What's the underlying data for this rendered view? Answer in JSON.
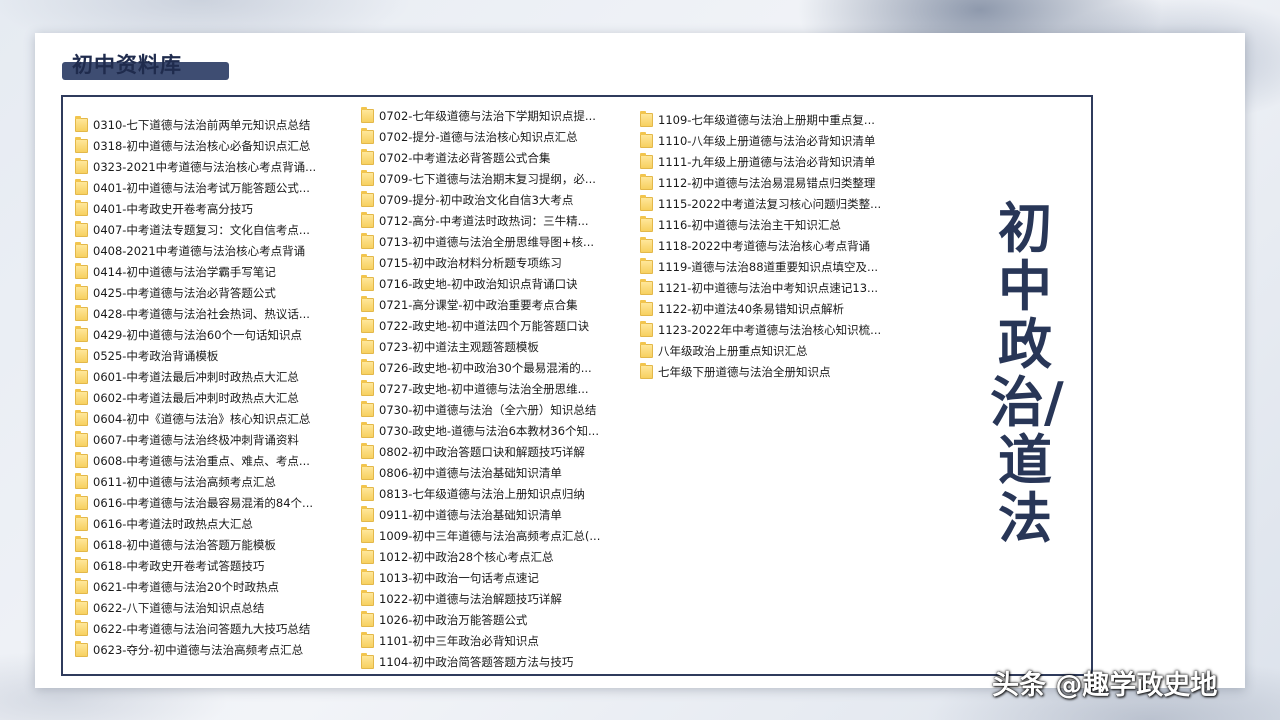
{
  "header": {
    "title": "初中资料库"
  },
  "side_title": "初中政治/道法",
  "watermark": "头条 @趣学政史地",
  "columns": [
    [
      "0310-七下道德与法治前两单元知识点总结",
      "0318-初中道德与法治核心必备知识点汇总",
      "0323-2021中考道德与法治核心考点背诵...",
      "0401-初中道德与法治考试万能答题公式...",
      "0401-中考政史开卷考高分技巧",
      "0407-中考道法专题复习：文化自信考点...",
      "0408-2021中考道德与法治核心考点背诵",
      "0414-初中道德与法治学霸手写笔记",
      "0425-中考道德与法治必背答题公式",
      "0428-中考道德与法治社会热词、热议话...",
      "0429-初中道德与法治60个一句话知识点",
      "0525-中考政治背诵模板",
      "0601-中考道法最后冲刺时政热点大汇总",
      "0602-中考道法最后冲刺时政热点大汇总",
      "0604-初中《道德与法治》核心知识点汇总",
      "0607-中考道德与法治终极冲刺背诵资料",
      "0608-中考道德与法治重点、难点、考点...",
      "0611-初中道德与法治高频考点汇总",
      "0616-中考道德与法治最容易混淆的84个...",
      "0616-中考道法时政热点大汇总",
      "0618-初中道德与法治答题万能模板",
      "0618-中考政史开卷考试答题技巧",
      "0621-中考道德与法治20个时政热点",
      "0622-八下道德与法治知识点总结",
      "0622-中考道德与法治问答题九大技巧总结",
      "0623-夺分-初中道德与法治高频考点汇总"
    ],
    [
      "0702-七年级道德与法治下学期知识点提...",
      "0702-提分-道德与法治核心知识点汇总",
      "0702-中考道法必背答题公式合集",
      "0709-七下道德与法治期末复习提纲，必...",
      "0709-提分-初中政治文化自信3大考点",
      "0712-高分-中考道法时政热词：三牛精...",
      "0713-初中道德与法治全册思维导图+核...",
      "0715-初中政治材料分析题专项练习",
      "0716-政史地-初中政治知识点背诵口诀",
      "0721-高分课堂-初中政治重要考点合集",
      "0722-政史地-初中道法四个万能答题口诀",
      "0723-初中道法主观题答题模板",
      "0726-政史地-初中政治30个最易混淆的...",
      "0727-政史地-初中道德与法治全册思维...",
      "0730-初中道德与法治（全六册）知识总结",
      "0730-政史地-道德与法治6本教材36个知...",
      "0802-初中政治答题口诀和解题技巧详解",
      "0806-初中道德与法治基础知识清单",
      "0813-七年级道德与法治上册知识点归纳",
      "0911-初中道德与法治基础知识清单",
      "1009-初中三年道德与法治高频考点汇总(...",
      "1012-初中政治28个核心考点汇总",
      "1013-初中政治一句话考点速记",
      "1022-初中道德与法治解题技巧详解",
      "1026-初中政治万能答题公式",
      "1101-初中三年政治必背知识点",
      "1104-初中政治简答题答题方法与技巧"
    ],
    [
      "1109-七年级道德与法治上册期中重点复...",
      "1110-八年级上册道德与法治必背知识清单",
      "1111-九年级上册道德与法治必背知识清单",
      "1112-初中道德与法治易混易错点归类整理",
      "1115-2022中考道法复习核心问题归类整...",
      "1116-初中道德与法治主干知识汇总",
      "1118-2022中考道德与法治核心考点背诵",
      "1119-道德与法治88道重要知识点填空及...",
      "1121-初中道德与法治中考知识点速记13...",
      "1122-初中道法40条易错知识点解析",
      "1123-2022年中考道德与法治核心知识梳...",
      "八年级政治上册重点知识汇总",
      "七年级下册道德与法治全册知识点"
    ]
  ]
}
